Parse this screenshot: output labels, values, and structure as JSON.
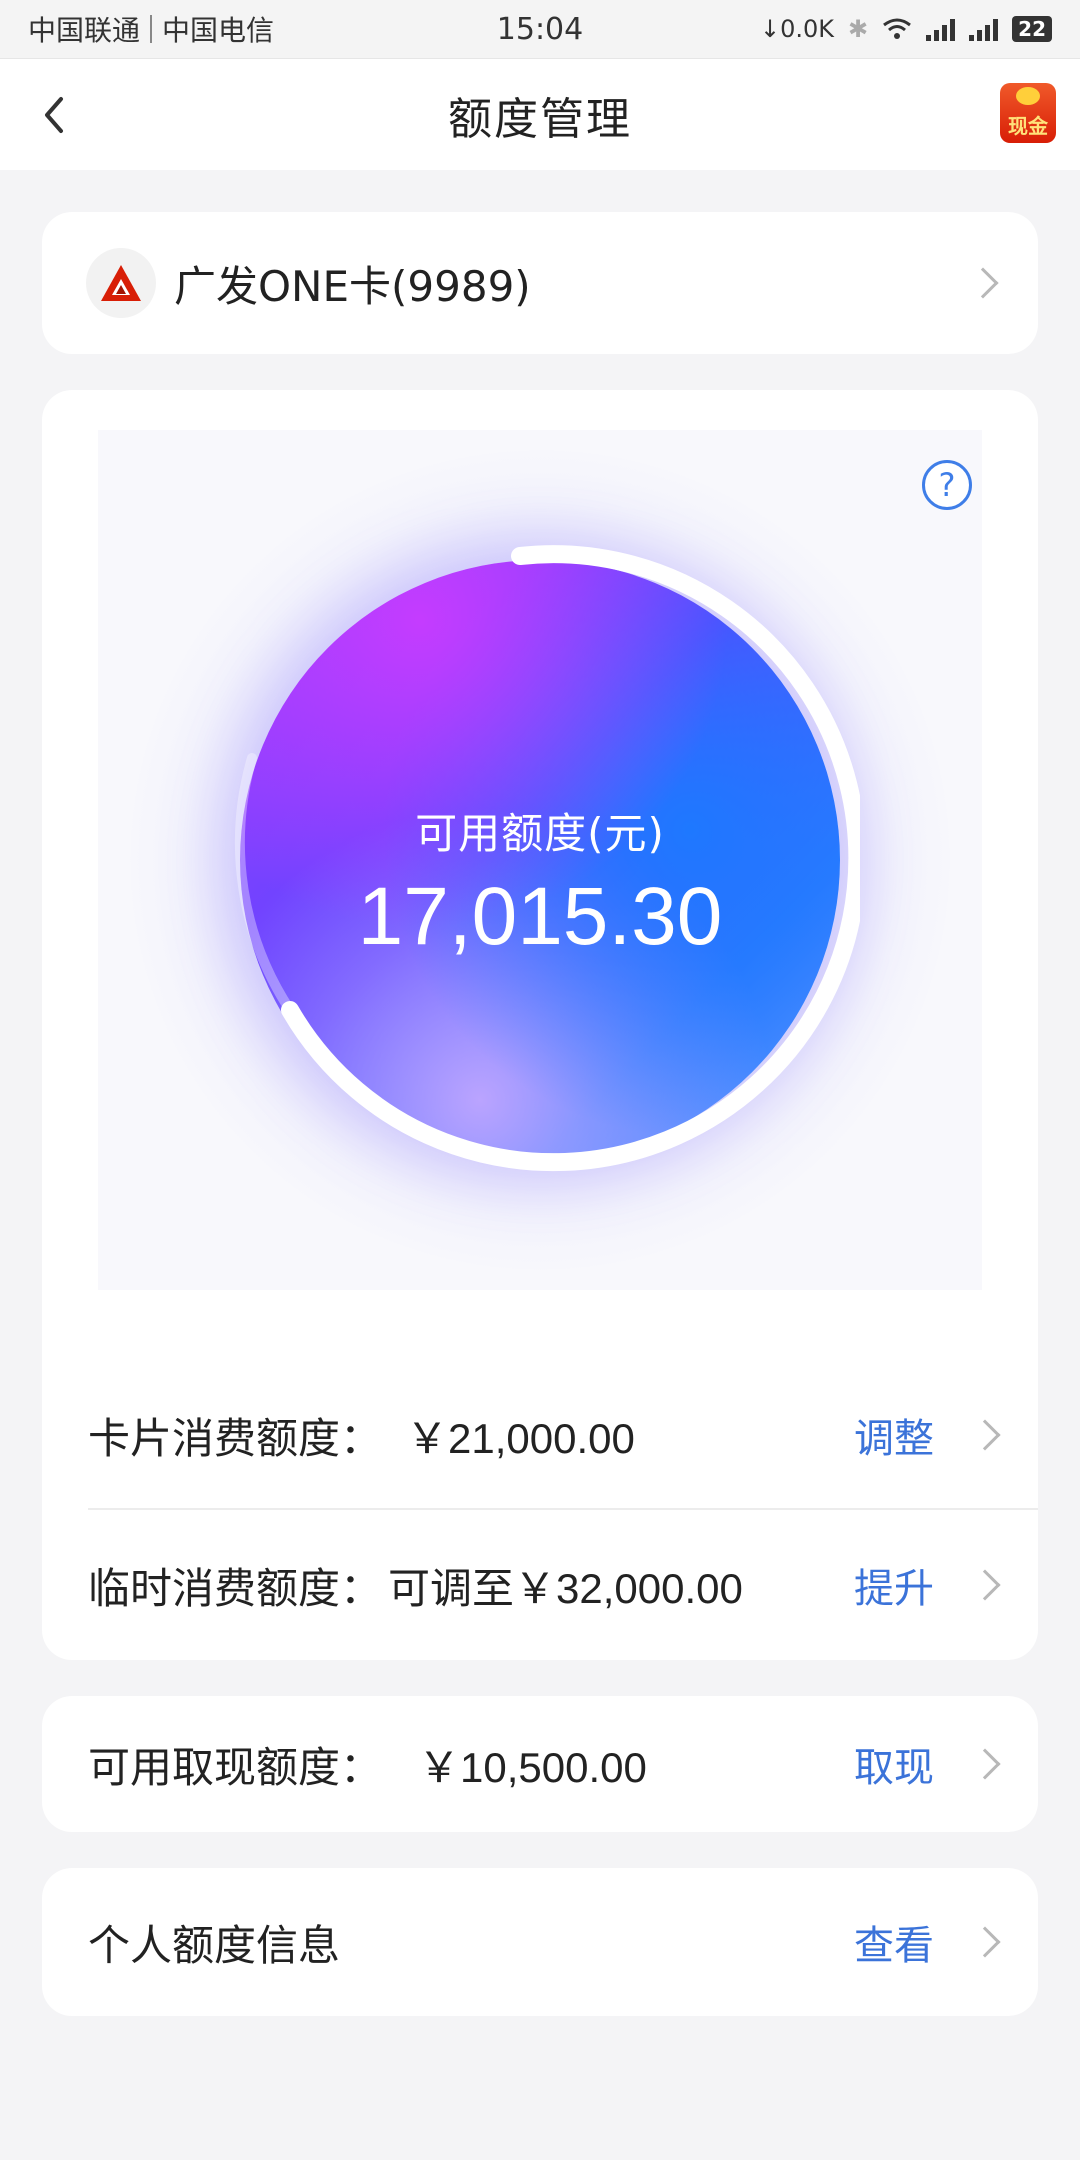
{
  "status_bar": {
    "carrier1": "中国联通",
    "carrier2": "中国电信",
    "time": "15:04",
    "net_speed": "0.0K",
    "battery": "22"
  },
  "header": {
    "title": "额度管理",
    "cash_icon_label": "现金"
  },
  "card": {
    "name": "广发ONE卡(9989)"
  },
  "gauge": {
    "label": "可用额度(元)",
    "value": "17,015.30"
  },
  "rows": {
    "consume": {
      "label": "卡片消费额度：",
      "value": "￥21,000.00",
      "action": "调整"
    },
    "temp": {
      "label": "临时消费额度：",
      "value": "可调至￥32,000.00",
      "action": "提升"
    },
    "cash": {
      "label": "可用取现额度：",
      "value": "￥10,500.00",
      "action": "取现"
    },
    "info": {
      "label": "个人额度信息",
      "action": "查看"
    }
  },
  "colors": {
    "accent": "#3b73d9",
    "background": "#f4f4f6",
    "brand_red": "#d81e06"
  }
}
